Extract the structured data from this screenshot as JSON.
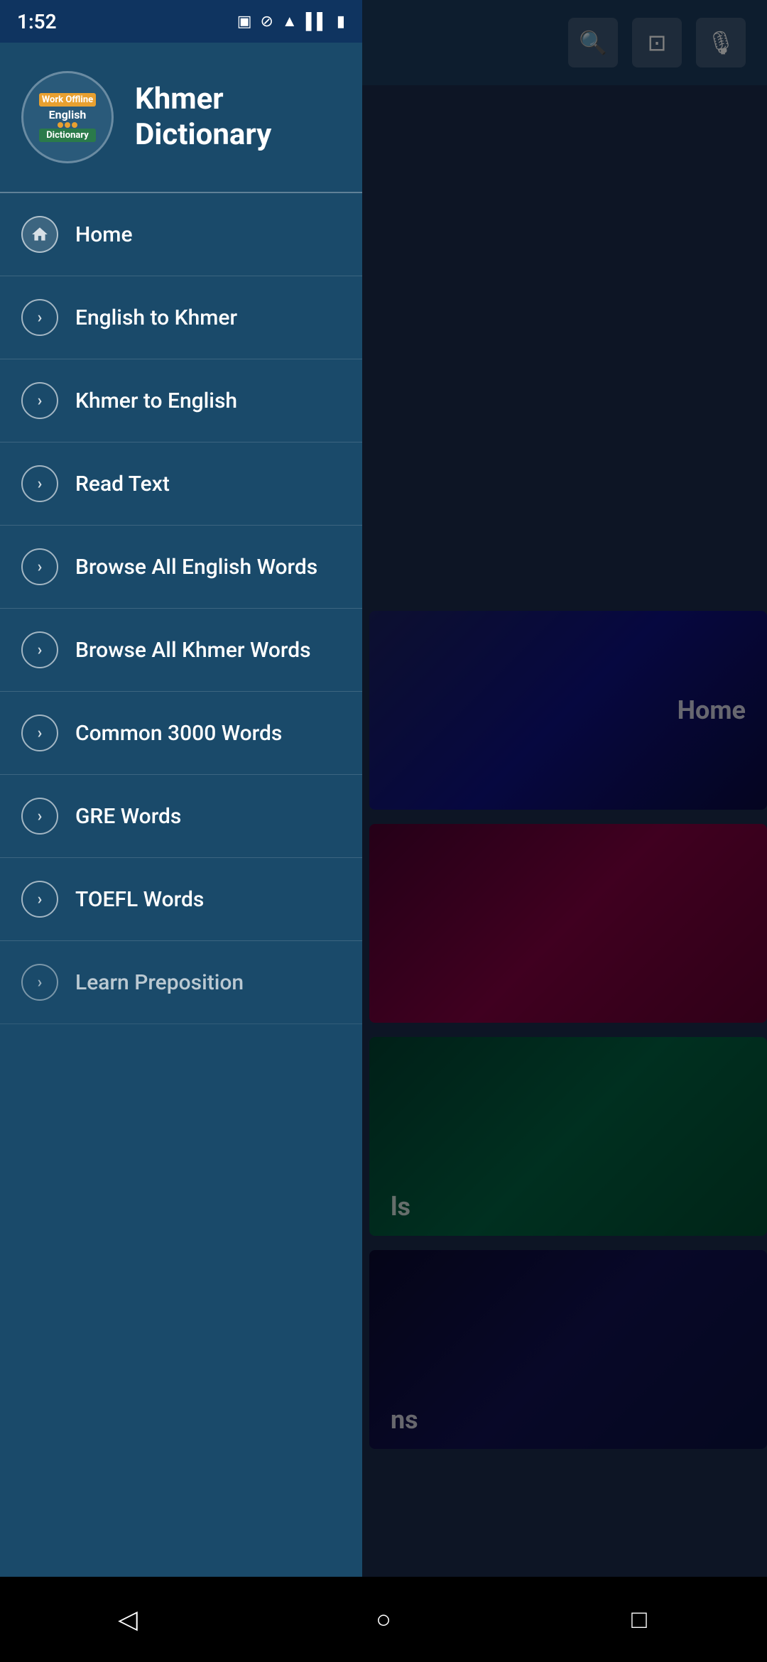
{
  "app": {
    "name": "Khmer Dictionary",
    "title_line1": "Khmer",
    "title_line2": "Dictionary"
  },
  "logo": {
    "work_offline": "Work Offline",
    "english": "English",
    "dictionary": "Dictionary"
  },
  "status_bar": {
    "time": "1:52",
    "icons": [
      "sim",
      "wifi",
      "battery"
    ]
  },
  "nav": {
    "items": [
      {
        "id": "home",
        "label": "Home",
        "icon": "home"
      },
      {
        "id": "english-to-khmer",
        "label": "English to Khmer",
        "icon": "arrow"
      },
      {
        "id": "khmer-to-english",
        "label": "Khmer to English",
        "icon": "arrow"
      },
      {
        "id": "read-text",
        "label": "Read Text",
        "icon": "arrow"
      },
      {
        "id": "browse-all-english",
        "label": "Browse All English Words",
        "icon": "arrow"
      },
      {
        "id": "browse-all-khmer",
        "label": "Browse All Khmer Words",
        "icon": "arrow"
      },
      {
        "id": "common-3000",
        "label": "Common 3000 Words",
        "icon": "arrow"
      },
      {
        "id": "gre-words",
        "label": "GRE Words",
        "icon": "arrow"
      },
      {
        "id": "toefl-words",
        "label": "TOEFL Words",
        "icon": "arrow"
      },
      {
        "id": "learn-preposition",
        "label": "Learn Preposition",
        "icon": "arrow"
      }
    ]
  },
  "toolbar": {
    "search_icon": "🔍",
    "camera_icon": "📷",
    "mic_icon": "🎤"
  },
  "bottom_nav": {
    "back": "◁",
    "home": "○",
    "recent": "□"
  }
}
